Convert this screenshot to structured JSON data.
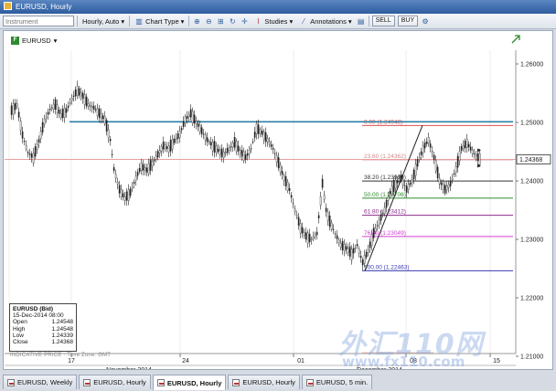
{
  "window": {
    "title": "EURUSD, Hourly"
  },
  "toolbar": {
    "instrument_placeholder": "Instrument",
    "interval_label": "Hourly, Auto",
    "chart_type_label": "Chart Type",
    "studies_label": "Studies",
    "annotations_label": "Annotations",
    "sell_label": "SELL",
    "buy_label": "BUY"
  },
  "chart": {
    "symbol": "EURUSD",
    "price_axis": [
      "1.26000",
      "1.25000",
      "1.24000",
      "1.23000",
      "1.22000",
      "1.21000"
    ],
    "current_price": "1.24368",
    "time_axis_days": [
      "17",
      "24",
      "01",
      "08",
      "15"
    ],
    "time_axis_months": [
      "November 2014",
      "December 2014"
    ],
    "fib_levels": [
      {
        "label": "0.00 (1.24948)",
        "color": "#d9534f"
      },
      {
        "label": "23.60 (1.24362)",
        "color": "#d08a8a"
      },
      {
        "label": "38.20 (1.23999)",
        "color": "#333333"
      },
      {
        "label": "50.00 (1.23706)",
        "color": "#2e8b2e"
      },
      {
        "label": "61.80 (1.23412)",
        "color": "#8b2a8b"
      },
      {
        "label": "76.40 (1.23049)",
        "color": "#d040d0"
      },
      {
        "label": "100.00 (1.22463)",
        "color": "#3a3ab0"
      }
    ],
    "colors": {
      "trendline": "#2b7fa8",
      "price_line": "#e8a0a0",
      "candles": "#222222"
    }
  },
  "legend": {
    "title": "EURUSD (Bid)",
    "datetime": "15-Dec-2014 08:00",
    "rows": [
      {
        "label": "Open",
        "value": "1.24548"
      },
      {
        "label": "High",
        "value": "1.24548"
      },
      {
        "label": "Low",
        "value": "1.24339"
      },
      {
        "label": "Close",
        "value": "1.24368"
      }
    ]
  },
  "indicative": "INDICATIVE PRICE · Time Zone: GMT",
  "watermark": {
    "logo": "外汇110网",
    "url": "www.fx110.com"
  },
  "tabs": [
    {
      "label": "EURUSD, Weekly",
      "active": false
    },
    {
      "label": "EURUSD, Hourly",
      "active": false
    },
    {
      "label": "EURUSD, Hourly",
      "active": true
    },
    {
      "label": "EURUSD, Hourly",
      "active": false
    },
    {
      "label": "EURUSD, 5 min.",
      "active": false
    }
  ]
}
